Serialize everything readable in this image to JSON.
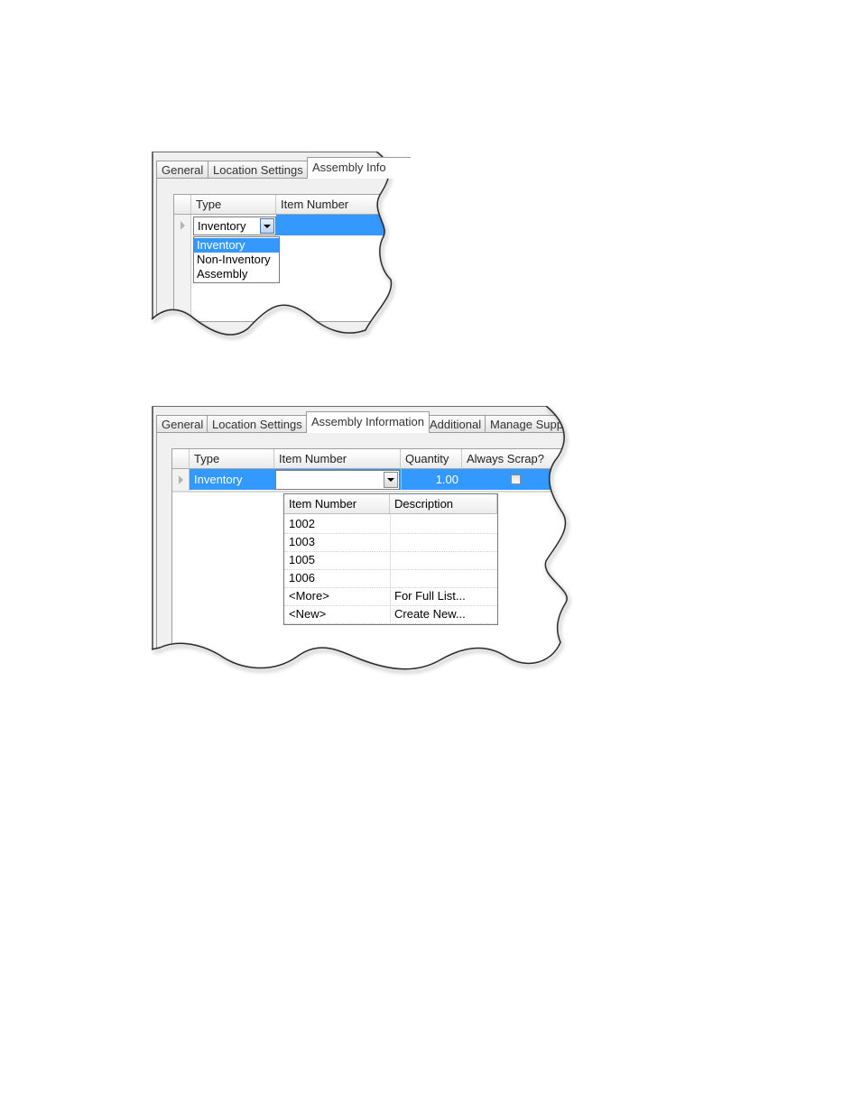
{
  "screenshot1": {
    "tabs": [
      "General",
      "Location Settings",
      "Assembly Info"
    ],
    "active_tab": "Assembly Info",
    "grid": {
      "columns": [
        "Type",
        "Item Number"
      ],
      "type_value": "Inventory"
    },
    "type_dropdown": {
      "options": [
        "Inventory",
        "Non-Inventory",
        "Assembly"
      ],
      "highlighted": "Inventory"
    }
  },
  "screenshot2": {
    "tabs": [
      "General",
      "Location Settings",
      "Assembly Information",
      "Additional",
      "Manage Supp"
    ],
    "active_tab": "Assembly Information",
    "grid": {
      "columns": [
        "Type",
        "Item Number",
        "Quantity",
        "Always Scrap?"
      ],
      "row": {
        "type": "Inventory",
        "item_number": "",
        "quantity": "1.00",
        "always_scrap": false
      }
    },
    "item_lookup": {
      "columns": [
        "Item Number",
        "Description"
      ],
      "rows": [
        {
          "item_number": "1002",
          "description": ""
        },
        {
          "item_number": "1003",
          "description": ""
        },
        {
          "item_number": "1005",
          "description": ""
        },
        {
          "item_number": "1006",
          "description": ""
        },
        {
          "item_number": "<More>",
          "description": "For Full List..."
        },
        {
          "item_number": "<New>",
          "description": "Create New..."
        }
      ]
    }
  },
  "colors": {
    "selection": "#3399ff",
    "panel": "#f0f0f0",
    "grid_bg": "#ffffff"
  }
}
